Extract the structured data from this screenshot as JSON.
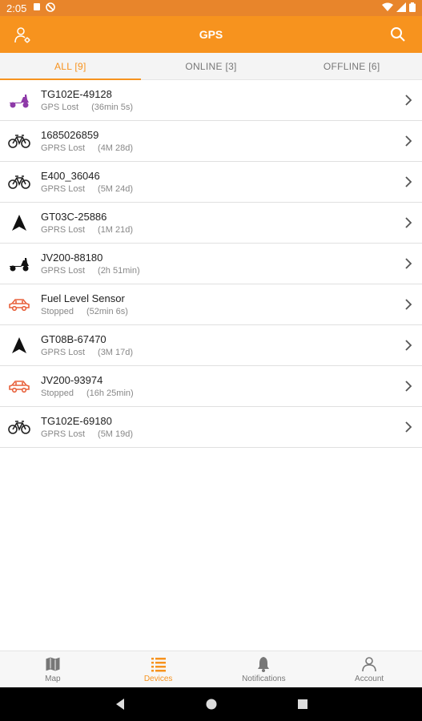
{
  "status_bar": {
    "time": "2:05"
  },
  "app_bar": {
    "title": "GPS"
  },
  "tabs": [
    {
      "label": "ALL [9]",
      "active": true
    },
    {
      "label": "ONLINE [3]",
      "active": false
    },
    {
      "label": "OFFLINE [6]",
      "active": false
    }
  ],
  "devices": [
    {
      "name": "TG102E-49128",
      "status": "GPS Lost",
      "duration": "(36min 5s)",
      "icon": "scooter-icon",
      "color": "#8e3aa8"
    },
    {
      "name": "1685026859",
      "status": "GPRS Lost",
      "duration": "(4M 28d)",
      "icon": "bicycle-icon",
      "color": "#222222"
    },
    {
      "name": "E400_36046",
      "status": "GPRS Lost",
      "duration": "(5M 24d)",
      "icon": "bicycle-icon",
      "color": "#222222"
    },
    {
      "name": "GT03C-25886",
      "status": "GPRS Lost",
      "duration": "(1M 21d)",
      "icon": "navigation-arrow-icon",
      "color": "#111111"
    },
    {
      "name": "JV200-88180",
      "status": "GPRS Lost",
      "duration": "(2h 51min)",
      "icon": "scooter-icon",
      "color": "#111111"
    },
    {
      "name": "Fuel Level Sensor",
      "status": "Stopped",
      "duration": "(52min 6s)",
      "icon": "car-icon",
      "color": "#e8613c"
    },
    {
      "name": "GT08B-67470",
      "status": "GPRS Lost",
      "duration": "(3M 17d)",
      "icon": "navigation-arrow-icon",
      "color": "#111111"
    },
    {
      "name": "JV200-93974",
      "status": "Stopped",
      "duration": "(16h 25min)",
      "icon": "car-icon",
      "color": "#e8613c"
    },
    {
      "name": "TG102E-69180",
      "status": "GPRS Lost",
      "duration": "(5M 19d)",
      "icon": "bicycle-icon",
      "color": "#222222"
    }
  ],
  "bottom_nav": [
    {
      "label": "Map",
      "icon": "map-icon",
      "active": false
    },
    {
      "label": "Devices",
      "icon": "list-icon",
      "active": true
    },
    {
      "label": "Notifications",
      "icon": "bell-icon",
      "active": false
    },
    {
      "label": "Account",
      "icon": "person-icon",
      "active": false
    }
  ],
  "colors": {
    "accent": "#f7931e",
    "status_bar": "#e8852b"
  }
}
